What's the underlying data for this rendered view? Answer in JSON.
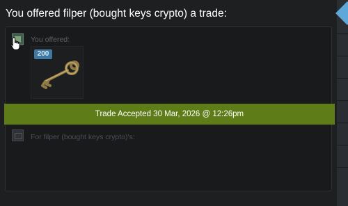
{
  "page": {
    "title": "You offered filper (bought keys crypto) a trade:"
  },
  "offer": {
    "you_label": "You offered:",
    "item": {
      "quantity_badge": "200",
      "icon": "key-icon"
    },
    "status": "Trade Accepted 30 Mar, 2026 @ 12:26pm",
    "their_label": "For filper (bought keys crypto)'s:"
  },
  "colors": {
    "banner": "#5e7c17",
    "badge": "#3f78a3",
    "nav_accent": "#5ea7d9"
  }
}
